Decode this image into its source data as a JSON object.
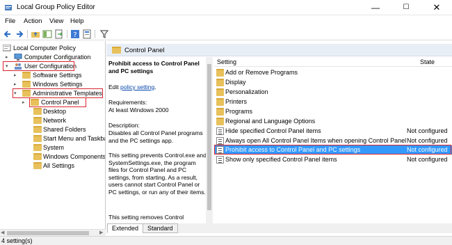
{
  "window": {
    "title": "Local Group Policy Editor"
  },
  "menu": [
    "File",
    "Action",
    "View",
    "Help"
  ],
  "tree": {
    "root": "Local Computer Policy",
    "items": [
      {
        "label": "Computer Configuration"
      },
      {
        "label": "User Configuration"
      },
      {
        "label": "Software Settings"
      },
      {
        "label": "Windows Settings"
      },
      {
        "label": "Administrative Templates"
      },
      {
        "label": "Control Panel"
      },
      {
        "label": "Desktop"
      },
      {
        "label": "Network"
      },
      {
        "label": "Shared Folders"
      },
      {
        "label": "Start Menu and Taskbar"
      },
      {
        "label": "System"
      },
      {
        "label": "Windows Components"
      },
      {
        "label": "All Settings"
      }
    ]
  },
  "banner": {
    "title": "Control Panel"
  },
  "description": {
    "heading": "Prohibit access to Control Panel and PC settings",
    "edit_prefix": "Edit",
    "edit_link": "policy setting",
    "edit_suffix": ".",
    "requirements_label": "Requirements:",
    "requirements_value": "At least Windows 2000",
    "description_label": "Description:",
    "p1": "Disables all Control Panel programs and the PC settings app.",
    "p2": "This setting prevents Control.exe and SystemSettings.exe, the program files for Control Panel and PC settings, from starting. As a result, users cannot start Control Panel or PC settings, or run any of their items.",
    "p3": "This setting removes Control"
  },
  "list": {
    "col_setting": "Setting",
    "col_state": "State",
    "rows": [
      {
        "name": "Add or Remove Programs",
        "state": "",
        "kind": "folder"
      },
      {
        "name": "Display",
        "state": "",
        "kind": "folder"
      },
      {
        "name": "Personalization",
        "state": "",
        "kind": "folder"
      },
      {
        "name": "Printers",
        "state": "",
        "kind": "folder"
      },
      {
        "name": "Programs",
        "state": "",
        "kind": "folder"
      },
      {
        "name": "Regional and Language Options",
        "state": "",
        "kind": "folder"
      },
      {
        "name": "Hide specified Control Panel items",
        "state": "Not configured",
        "kind": "policy"
      },
      {
        "name": "Always open All Control Panel Items when opening Control Panel",
        "state": "Not configured",
        "kind": "policy"
      },
      {
        "name": "Prohibit access to Control Panel and PC settings",
        "state": "Not configured",
        "kind": "policy"
      },
      {
        "name": "Show only specified Control Panel items",
        "state": "Not configured",
        "kind": "policy"
      }
    ]
  },
  "tabs": [
    "Extended",
    "Standard"
  ],
  "status": "4 setting(s)",
  "colors": {
    "selection": "#3399ff",
    "highlight_border": "#d9232e",
    "banner": "#e8eef6"
  }
}
